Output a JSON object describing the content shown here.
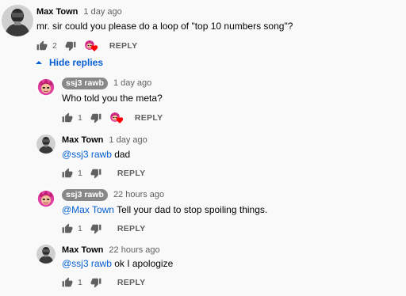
{
  "comments": [
    {
      "author": "Max Town",
      "time": "1 day ago",
      "text": "mr. sir could you please do a loop of \"top 10 numbers song\"?",
      "likes": "2",
      "reply_label": "REPLY",
      "hearted": true
    }
  ],
  "hide_replies_label": "Hide replies",
  "replies": [
    {
      "author": "ssj3 rawb",
      "author_is_creator": true,
      "time": "1 day ago",
      "mention": "",
      "text": "Who told you the meta?",
      "likes": "1",
      "reply_label": "REPLY",
      "hearted": true
    },
    {
      "author": "Max Town",
      "author_is_creator": false,
      "time": "1 day ago",
      "mention": "@ssj3 rawb",
      "text": " dad",
      "likes": "1",
      "reply_label": "REPLY",
      "hearted": false
    },
    {
      "author": "ssj3 rawb",
      "author_is_creator": true,
      "time": "22 hours ago",
      "mention": "@Max Town",
      "text": " Tell your dad to stop spoiling things.",
      "likes": "1",
      "reply_label": "REPLY",
      "hearted": false
    },
    {
      "author": "Max Town",
      "author_is_creator": false,
      "time": "22 hours ago",
      "mention": "@ssj3 rawb",
      "text": " ok I apologize",
      "likes": "1",
      "reply_label": "REPLY",
      "hearted": false
    }
  ],
  "colors": {
    "link": "#065fd4",
    "heart": "#ff0000",
    "chip": "#888888",
    "secondary_text": "#606060"
  },
  "icons": [
    "thumb-up-icon",
    "thumb-down-icon",
    "chevron-up-icon",
    "heart-icon"
  ]
}
